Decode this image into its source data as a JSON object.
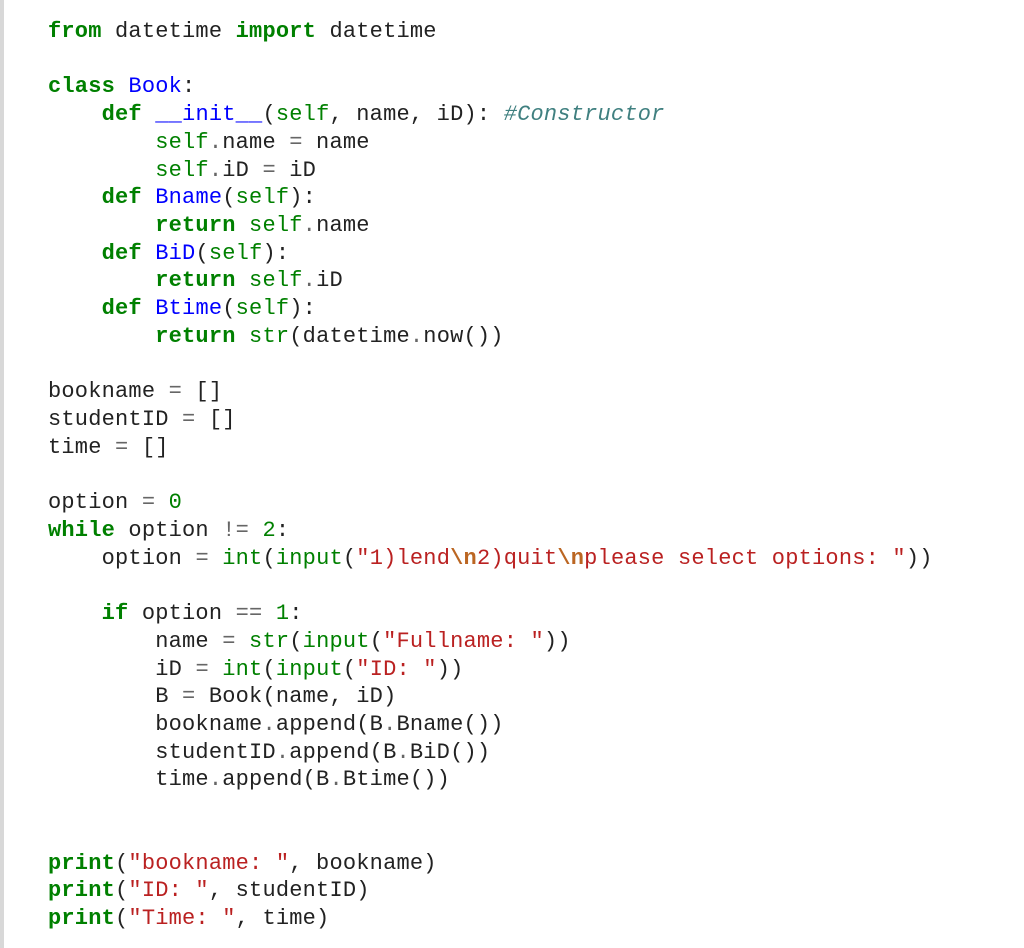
{
  "code": {
    "lines": [
      [
        {
          "c": "kw",
          "t": "from"
        },
        {
          "c": "t",
          "t": " datetime "
        },
        {
          "c": "kw",
          "t": "import"
        },
        {
          "c": "t",
          "t": " datetime"
        }
      ],
      [],
      [
        {
          "c": "kw",
          "t": "class"
        },
        {
          "c": "t",
          "t": " "
        },
        {
          "c": "fn",
          "t": "Book"
        },
        {
          "c": "t",
          "t": ":"
        }
      ],
      [
        {
          "c": "t",
          "t": "    "
        },
        {
          "c": "kw",
          "t": "def"
        },
        {
          "c": "t",
          "t": " "
        },
        {
          "c": "mg",
          "t": "__init__"
        },
        {
          "c": "t",
          "t": "("
        },
        {
          "c": "bi",
          "t": "self"
        },
        {
          "c": "t",
          "t": ", name, iD): "
        },
        {
          "c": "cm",
          "t": "#Constructor"
        }
      ],
      [
        {
          "c": "t",
          "t": "        "
        },
        {
          "c": "bi",
          "t": "self"
        },
        {
          "c": "op",
          "t": "."
        },
        {
          "c": "t",
          "t": "name "
        },
        {
          "c": "op",
          "t": "="
        },
        {
          "c": "t",
          "t": " name"
        }
      ],
      [
        {
          "c": "t",
          "t": "        "
        },
        {
          "c": "bi",
          "t": "self"
        },
        {
          "c": "op",
          "t": "."
        },
        {
          "c": "t",
          "t": "iD "
        },
        {
          "c": "op",
          "t": "="
        },
        {
          "c": "t",
          "t": " iD"
        }
      ],
      [
        {
          "c": "t",
          "t": "    "
        },
        {
          "c": "kw",
          "t": "def"
        },
        {
          "c": "t",
          "t": " "
        },
        {
          "c": "fn",
          "t": "Bname"
        },
        {
          "c": "t",
          "t": "("
        },
        {
          "c": "bi",
          "t": "self"
        },
        {
          "c": "t",
          "t": "):"
        }
      ],
      [
        {
          "c": "t",
          "t": "        "
        },
        {
          "c": "kw",
          "t": "return"
        },
        {
          "c": "t",
          "t": " "
        },
        {
          "c": "bi",
          "t": "self"
        },
        {
          "c": "op",
          "t": "."
        },
        {
          "c": "t",
          "t": "name"
        }
      ],
      [
        {
          "c": "t",
          "t": "    "
        },
        {
          "c": "kw",
          "t": "def"
        },
        {
          "c": "t",
          "t": " "
        },
        {
          "c": "fn",
          "t": "BiD"
        },
        {
          "c": "t",
          "t": "("
        },
        {
          "c": "bi",
          "t": "self"
        },
        {
          "c": "t",
          "t": "):"
        }
      ],
      [
        {
          "c": "t",
          "t": "        "
        },
        {
          "c": "kw",
          "t": "return"
        },
        {
          "c": "t",
          "t": " "
        },
        {
          "c": "bi",
          "t": "self"
        },
        {
          "c": "op",
          "t": "."
        },
        {
          "c": "t",
          "t": "iD"
        }
      ],
      [
        {
          "c": "t",
          "t": "    "
        },
        {
          "c": "kw",
          "t": "def"
        },
        {
          "c": "t",
          "t": " "
        },
        {
          "c": "fn",
          "t": "Btime"
        },
        {
          "c": "t",
          "t": "("
        },
        {
          "c": "bi",
          "t": "self"
        },
        {
          "c": "t",
          "t": "):"
        }
      ],
      [
        {
          "c": "t",
          "t": "        "
        },
        {
          "c": "kw",
          "t": "return"
        },
        {
          "c": "t",
          "t": " "
        },
        {
          "c": "bi",
          "t": "str"
        },
        {
          "c": "t",
          "t": "(datetime"
        },
        {
          "c": "op",
          "t": "."
        },
        {
          "c": "t",
          "t": "now())"
        }
      ],
      [],
      [
        {
          "c": "t",
          "t": "bookname "
        },
        {
          "c": "op",
          "t": "="
        },
        {
          "c": "t",
          "t": " []"
        }
      ],
      [
        {
          "c": "t",
          "t": "studentID "
        },
        {
          "c": "op",
          "t": "="
        },
        {
          "c": "t",
          "t": " []"
        }
      ],
      [
        {
          "c": "t",
          "t": "time "
        },
        {
          "c": "op",
          "t": "="
        },
        {
          "c": "t",
          "t": " []"
        }
      ],
      [],
      [
        {
          "c": "t",
          "t": "option "
        },
        {
          "c": "op",
          "t": "="
        },
        {
          "c": "t",
          "t": " "
        },
        {
          "c": "num",
          "t": "0"
        }
      ],
      [
        {
          "c": "kw",
          "t": "while"
        },
        {
          "c": "t",
          "t": " option "
        },
        {
          "c": "op",
          "t": "!="
        },
        {
          "c": "t",
          "t": " "
        },
        {
          "c": "num",
          "t": "2"
        },
        {
          "c": "t",
          "t": ":"
        }
      ],
      [
        {
          "c": "t",
          "t": "    option "
        },
        {
          "c": "op",
          "t": "="
        },
        {
          "c": "t",
          "t": " "
        },
        {
          "c": "bi",
          "t": "int"
        },
        {
          "c": "t",
          "t": "("
        },
        {
          "c": "bi",
          "t": "input"
        },
        {
          "c": "t",
          "t": "("
        },
        {
          "c": "str",
          "t": "\"1)lend"
        },
        {
          "c": "se",
          "t": "\\n"
        },
        {
          "c": "str",
          "t": "2)quit"
        },
        {
          "c": "se",
          "t": "\\n"
        },
        {
          "c": "str",
          "t": "please select options: \""
        },
        {
          "c": "t",
          "t": "))"
        }
      ],
      [
        {
          "c": "t",
          "t": "    "
        }
      ],
      [
        {
          "c": "t",
          "t": "    "
        },
        {
          "c": "kw",
          "t": "if"
        },
        {
          "c": "t",
          "t": " option "
        },
        {
          "c": "op",
          "t": "=="
        },
        {
          "c": "t",
          "t": " "
        },
        {
          "c": "num",
          "t": "1"
        },
        {
          "c": "t",
          "t": ":"
        }
      ],
      [
        {
          "c": "t",
          "t": "        name "
        },
        {
          "c": "op",
          "t": "="
        },
        {
          "c": "t",
          "t": " "
        },
        {
          "c": "bi",
          "t": "str"
        },
        {
          "c": "t",
          "t": "("
        },
        {
          "c": "bi",
          "t": "input"
        },
        {
          "c": "t",
          "t": "("
        },
        {
          "c": "str",
          "t": "\"Fullname: \""
        },
        {
          "c": "t",
          "t": "))"
        }
      ],
      [
        {
          "c": "t",
          "t": "        iD "
        },
        {
          "c": "op",
          "t": "="
        },
        {
          "c": "t",
          "t": " "
        },
        {
          "c": "bi",
          "t": "int"
        },
        {
          "c": "t",
          "t": "("
        },
        {
          "c": "bi",
          "t": "input"
        },
        {
          "c": "t",
          "t": "("
        },
        {
          "c": "str",
          "t": "\"ID: \""
        },
        {
          "c": "t",
          "t": "))"
        }
      ],
      [
        {
          "c": "t",
          "t": "        B "
        },
        {
          "c": "op",
          "t": "="
        },
        {
          "c": "t",
          "t": " Book(name, iD)"
        }
      ],
      [
        {
          "c": "t",
          "t": "        bookname"
        },
        {
          "c": "op",
          "t": "."
        },
        {
          "c": "t",
          "t": "append(B"
        },
        {
          "c": "op",
          "t": "."
        },
        {
          "c": "t",
          "t": "Bname())"
        }
      ],
      [
        {
          "c": "t",
          "t": "        studentID"
        },
        {
          "c": "op",
          "t": "."
        },
        {
          "c": "t",
          "t": "append(B"
        },
        {
          "c": "op",
          "t": "."
        },
        {
          "c": "t",
          "t": "BiD())"
        }
      ],
      [
        {
          "c": "t",
          "t": "        time"
        },
        {
          "c": "op",
          "t": "."
        },
        {
          "c": "t",
          "t": "append(B"
        },
        {
          "c": "op",
          "t": "."
        },
        {
          "c": "t",
          "t": "Btime())"
        }
      ],
      [
        {
          "c": "t",
          "t": "        "
        }
      ],
      [
        {
          "c": "t",
          "t": "        "
        }
      ],
      [
        {
          "c": "kw",
          "t": "print"
        },
        {
          "c": "t",
          "t": "("
        },
        {
          "c": "str",
          "t": "\"bookname: \""
        },
        {
          "c": "t",
          "t": ", bookname)"
        }
      ],
      [
        {
          "c": "kw",
          "t": "print"
        },
        {
          "c": "t",
          "t": "("
        },
        {
          "c": "str",
          "t": "\"ID: \""
        },
        {
          "c": "t",
          "t": ", studentID)"
        }
      ],
      [
        {
          "c": "kw",
          "t": "print"
        },
        {
          "c": "t",
          "t": "("
        },
        {
          "c": "str",
          "t": "\"Time: \""
        },
        {
          "c": "t",
          "t": ", time)"
        }
      ]
    ]
  }
}
